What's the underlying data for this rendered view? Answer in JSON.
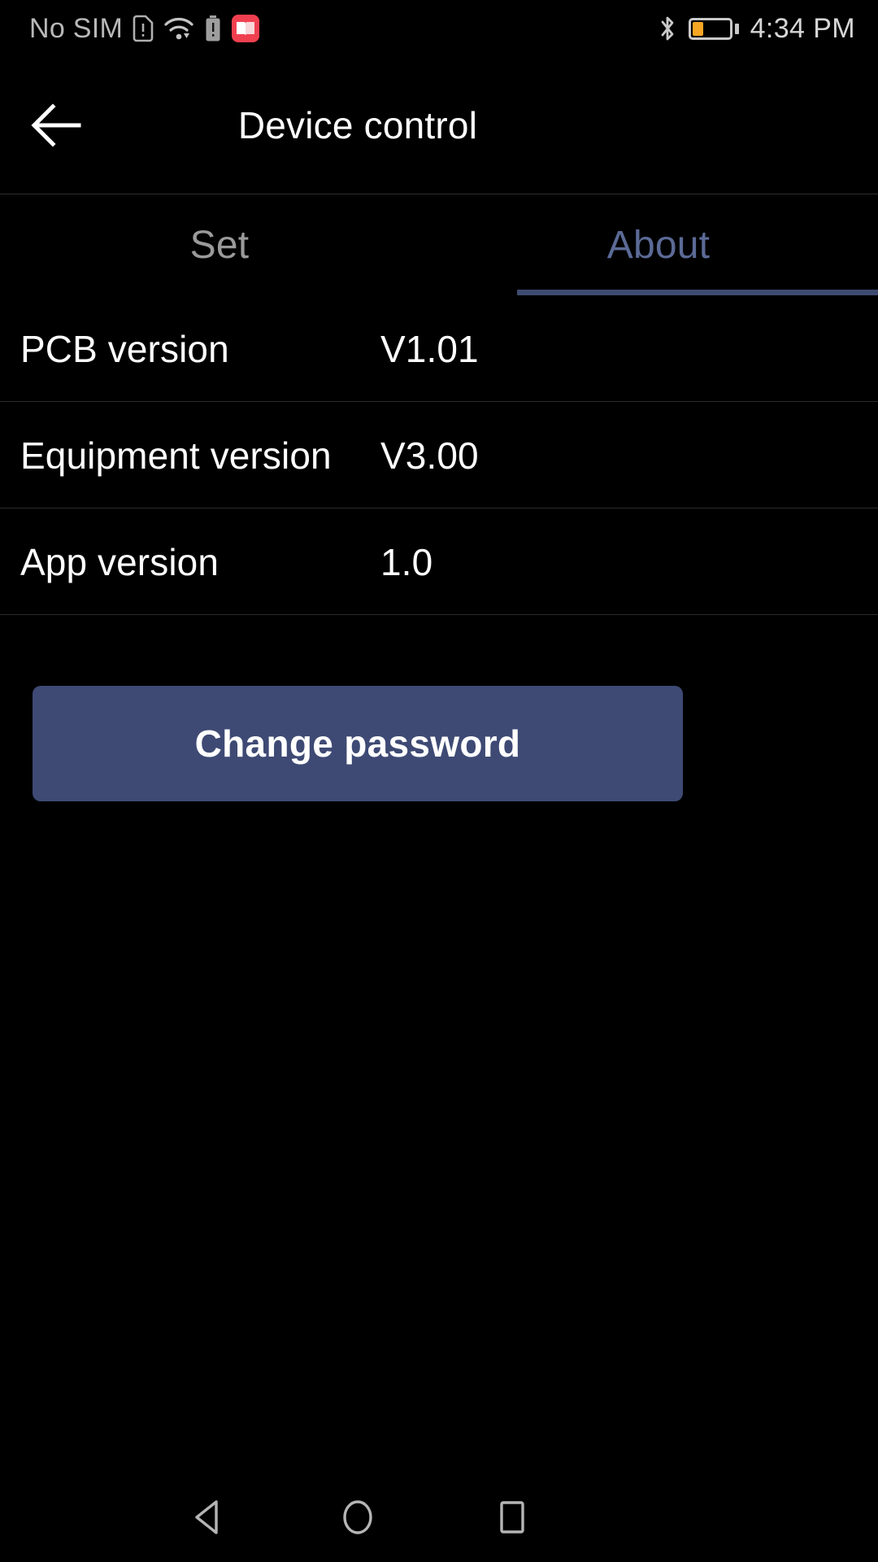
{
  "status_bar": {
    "carrier": "No SIM",
    "time": "4:34 PM",
    "battery_percent": 30,
    "battery_color": "#F5A623",
    "icons": [
      "sim-alert-icon",
      "wifi-icon",
      "battery-alert-icon",
      "book-app-icon",
      "bluetooth-icon",
      "battery-icon"
    ]
  },
  "app_bar": {
    "title": "Device control",
    "back_icon": "arrow-left-icon"
  },
  "tabs": [
    {
      "label": "Set",
      "active": false
    },
    {
      "label": "About",
      "active": true
    }
  ],
  "theme": {
    "background": "#000000",
    "accent": "#3E4A74",
    "tab_active_text": "#5B6A96",
    "tab_inactive_text": "#9A9A9A",
    "divider": "#2B2B2B",
    "text_primary": "#FFFFFF"
  },
  "about_rows": [
    {
      "label": "PCB version",
      "value": "V1.01"
    },
    {
      "label": "Equipment version",
      "value": "V3.00"
    },
    {
      "label": "App version",
      "value": "1.0"
    }
  ],
  "primary_action": {
    "label": "Change password"
  },
  "nav_bar": {
    "back_label": "back-triangle-icon",
    "home_label": "home-circle-icon",
    "recents_label": "recents-square-icon"
  }
}
